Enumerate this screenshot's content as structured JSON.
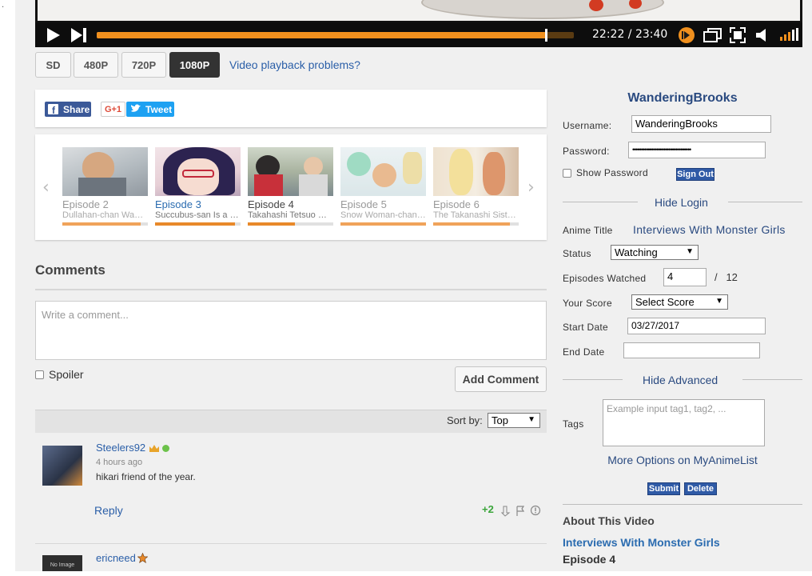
{
  "player": {
    "time": "22:22 / 23:40",
    "progress_fraction": 0.941,
    "qualities": [
      {
        "label": "SD",
        "active": false
      },
      {
        "label": "480P",
        "active": false
      },
      {
        "label": "720P",
        "active": false
      },
      {
        "label": "1080P",
        "active": true
      }
    ],
    "problems_link": "Video playback problems?"
  },
  "share": {
    "facebook": "Share",
    "googleplus": "G+1",
    "twitter": "Tweet"
  },
  "episodes": [
    {
      "title": "Episode 2",
      "subtitle": "Dullahan-chan Wants to Be Pampered",
      "watched_fraction": 0.92,
      "state": "faded"
    },
    {
      "title": "Episode 3",
      "subtitle": "Succubus-san Is a Delicate Age",
      "watched_fraction": 0.93,
      "state": "current"
    },
    {
      "title": "Episode 4",
      "subtitle": "Takahashi Tetsuo Wants to Protect",
      "watched_fraction": 0.55,
      "state": "dark"
    },
    {
      "title": "Episode 5",
      "subtitle": "Snow Woman-chan Wants to Get Along",
      "watched_fraction": 1.0,
      "state": "faded"
    },
    {
      "title": "Episode 6",
      "subtitle": "The Takanashi Sisters Want to Fight",
      "watched_fraction": 0.9,
      "state": "faded"
    }
  ],
  "comments": {
    "heading": "Comments",
    "placeholder": "Write a comment...",
    "spoiler_label": "Spoiler",
    "add_button": "Add Comment",
    "sort_label": "Sort by:",
    "sort_value": "Top",
    "items": [
      {
        "user": "Steelers92",
        "time": "4 hours ago",
        "text": "hikari friend of the year.",
        "reply": "Reply",
        "votes": "+2"
      },
      {
        "user": "ericneed",
        "avatar_text": "No Image"
      }
    ]
  },
  "account": {
    "display_name": "WanderingBrooks",
    "username_label": "Username:",
    "username_value": "WanderingBrooks",
    "password_label": "Password:",
    "password_mask": "••••••••••••••••••••••••••••••••••",
    "show_password_label": "Show Password",
    "sign_out": "Sign Out",
    "hide_login": "Hide Login"
  },
  "tracker": {
    "anime_title_label": "Anime Title",
    "anime_title": "Interviews With Monster Girls",
    "status_label": "Status",
    "status_value": "Watching",
    "episodes_label": "Episodes Watched",
    "episodes_value": "4",
    "episodes_total": "/   12",
    "score_label": "Your Score",
    "score_value": "Select Score",
    "start_label": "Start Date",
    "start_value": "03/27/2017",
    "end_label": "End Date",
    "end_value": "",
    "hide_advanced": "Hide Advanced",
    "tags_label": "Tags",
    "tags_placeholder": "Example input tag1, tag2, ...",
    "more_options": "More Options on MyAnimeList",
    "submit": "Submit",
    "delete": "Delete"
  },
  "about": {
    "heading": "About This Video",
    "anime": "Interviews With Monster Girls",
    "episode": "Episode 4"
  },
  "colors": {
    "accent_orange": "#f0901e",
    "link_blue": "#2b5fa8",
    "mal_blue": "#2f5aa6"
  }
}
